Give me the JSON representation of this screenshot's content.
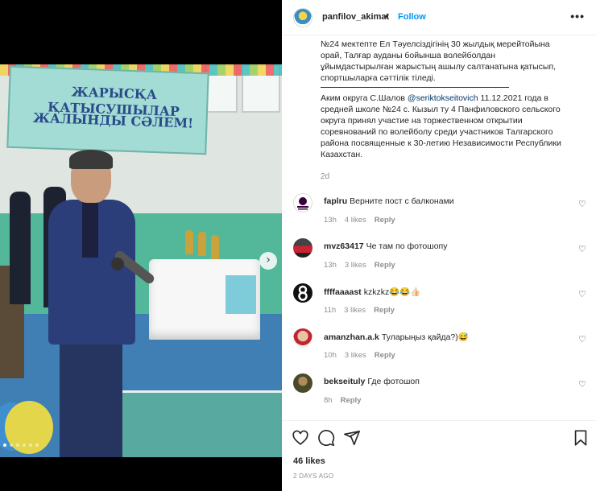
{
  "post": {
    "username": "panfilov_akimat",
    "separator": "•",
    "follow_label": "Follow",
    "more_label": "•••",
    "caption_kz": "№24 мектепте Ел Тәуелсіздігінің 30 жылдық мерейтойына орай, Талғар ауданы бойынша волейболдан ұйымдастырылған жарыстың ашылу салтанатына қатысып, спортшыларға сәттілік тіледі.",
    "caption_ru_prefix": "Аким округа С.Шалов ",
    "caption_mention": "@seriktokseitovich",
    "caption_ru_suffix": " 11.12.2021 года в средней школе №24 с. Кызыл ту 4 Панфиловского сельского округа принял участие на торжественном открытии соревнований по волейболу среди участников Талгарского района посвященные к 30-летию Независимости Республики Казахстан.",
    "caption_time": "2d",
    "likes": "46 likes",
    "date": "2 DAYS AGO"
  },
  "photo": {
    "banner_line1": "ЖАРЫСҚА ҚАТЫСУШЫЛАР",
    "banner_line2": "ЖАЛЫНДЫ СӘЛЕМ!"
  },
  "carousel": {
    "next_icon": "›",
    "slide_count": 6,
    "active_index": 0
  },
  "comments": [
    {
      "user": "faplru",
      "text": "Верните пост с балконами",
      "time": "13h",
      "likes": "4 likes",
      "reply": "Reply",
      "avatar": "premier-league-logo"
    },
    {
      "user": "mvz63417",
      "text": "Че там по фотошопу",
      "time": "13h",
      "likes": "3 likes",
      "reply": "Reply",
      "avatar": "red-car-photo"
    },
    {
      "user": "ffffaaaast",
      "text": "kzkzkz😂😂👍🏻",
      "time": "11h",
      "likes": "3 likes",
      "reply": "Reply",
      "avatar": "number-8-logo"
    },
    {
      "user": "amanzhan.a.k",
      "text": "Тулары​ңыз қайда?)😅",
      "time": "10h",
      "likes": "3 likes",
      "reply": "Reply",
      "avatar": "person-photo"
    },
    {
      "user": "bekseituly",
      "text": "Где фотошоп",
      "time": "8h",
      "likes": "",
      "reply": "Reply",
      "avatar": "person-photo-dark"
    }
  ],
  "icons": {
    "heart": "heart-icon",
    "comment": "comment-icon",
    "share": "share-icon",
    "save": "bookmark-icon"
  }
}
